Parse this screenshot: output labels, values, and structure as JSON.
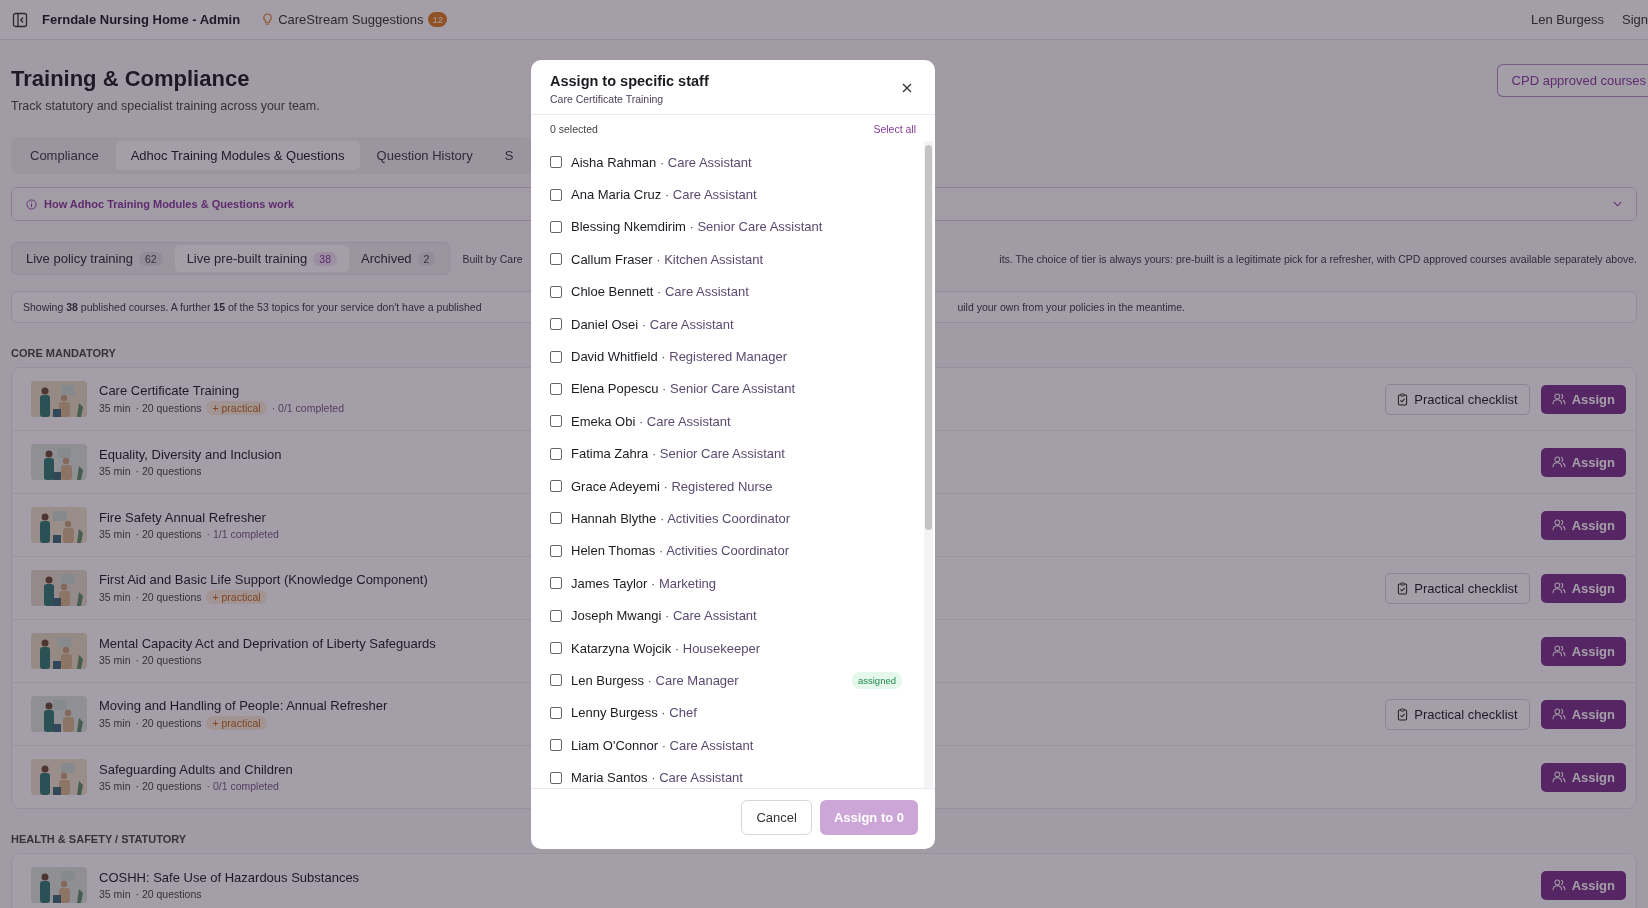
{
  "topbar": {
    "org": "Ferndale Nursing Home - Admin",
    "suggestions": "CareStream Suggestions",
    "suggestions_count": "12",
    "user": "Len Burgess",
    "sign": "Sign"
  },
  "header": {
    "title": "Training & Compliance",
    "subtitle": "Track statutory and specialist training across your team.",
    "cpd_button": "CPD approved courses"
  },
  "tabs": [
    {
      "label": "Compliance",
      "selected": false
    },
    {
      "label": "Adhoc Training Modules & Questions",
      "selected": true
    },
    {
      "label": "Question History",
      "selected": false
    },
    {
      "label": "S",
      "selected": false
    }
  ],
  "info_panel": {
    "label": "How Adhoc Training Modules & Questions work",
    "expanded": false
  },
  "subtabs": [
    {
      "label": "Live policy training",
      "count": "62",
      "selected": false
    },
    {
      "label": "Live pre-built training",
      "count": "38",
      "selected": true
    },
    {
      "label": "Archived",
      "count": "2",
      "selected": false
    }
  ],
  "subtabs_note_left": "Built by Care",
  "subtabs_note_right": "its. The choice of tier is always yours: pre-built is a legitimate pick for a refresher, with CPD approved courses available separately above.",
  "showing_left": "Showing **38** published courses. A further **15** of the 53 topics for your service don't have a published",
  "showing_right": "uild your own from your policies in the meantime.",
  "sections": [
    {
      "heading": "CORE MANDATORY",
      "courses": [
        {
          "title": "Care Certificate Training",
          "duration": "35 min",
          "questions": "· 20 questions",
          "practical": "+ practical",
          "completed": "· 0/1 completed",
          "checklist": "Practical checklist",
          "assign": "Assign"
        },
        {
          "title": "Equality, Diversity and Inclusion",
          "duration": "35 min",
          "questions": "· 20 questions",
          "assign": "Assign"
        },
        {
          "title": "Fire Safety Annual Refresher",
          "duration": "35 min",
          "questions": "· 20 questions",
          "completed": "· 1/1 completed",
          "assign": "Assign"
        },
        {
          "title": "First Aid and Basic Life Support (Knowledge Component)",
          "duration": "35 min",
          "questions": "· 20 questions",
          "practical": "+ practical",
          "checklist": "Practical checklist",
          "assign": "Assign"
        },
        {
          "title": "Mental Capacity Act and Deprivation of Liberty Safeguards",
          "duration": "35 min",
          "questions": "· 20 questions",
          "assign": "Assign"
        },
        {
          "title": "Moving and Handling of People: Annual Refresher",
          "duration": "35 min",
          "questions": "· 20 questions",
          "practical": "+ practical",
          "checklist": "Practical checklist",
          "assign": "Assign"
        },
        {
          "title": "Safeguarding Adults and Children",
          "duration": "35 min",
          "questions": "· 20 questions",
          "completed": "· 0/1 completed",
          "assign": "Assign"
        }
      ]
    },
    {
      "heading": "HEALTH & SAFETY / STATUTORY",
      "courses": [
        {
          "title": "COSHH: Safe Use of Hazardous Substances",
          "duration": "35 min",
          "questions": "· 20 questions",
          "assign": "Assign"
        }
      ]
    }
  ],
  "modal": {
    "title": "Assign to specific staff",
    "subtitle": "Care Certificate Training",
    "selected_count": "0 selected",
    "select_all": "Select all",
    "staff": [
      {
        "name": "Aisha Rahman",
        "role": "· Care Assistant",
        "checked": false
      },
      {
        "name": "Ana Maria Cruz",
        "role": "· Care Assistant",
        "checked": false
      },
      {
        "name": "Blessing Nkemdirim",
        "role": "· Senior Care Assistant",
        "checked": false
      },
      {
        "name": "Callum Fraser",
        "role": "· Kitchen Assistant",
        "checked": false
      },
      {
        "name": "Chloe Bennett",
        "role": "· Care Assistant",
        "checked": false
      },
      {
        "name": "Daniel Osei",
        "role": "· Care Assistant",
        "checked": false
      },
      {
        "name": "David Whitfield",
        "role": "· Registered Manager",
        "checked": false
      },
      {
        "name": "Elena Popescu",
        "role": "· Senior Care Assistant",
        "checked": false
      },
      {
        "name": "Emeka Obi",
        "role": "· Care Assistant",
        "checked": false
      },
      {
        "name": "Fatima Zahra",
        "role": "· Senior Care Assistant",
        "checked": false
      },
      {
        "name": "Grace Adeyemi",
        "role": "· Registered Nurse",
        "checked": false
      },
      {
        "name": "Hannah Blythe",
        "role": "· Activities Coordinator",
        "checked": false
      },
      {
        "name": "Helen Thomas",
        "role": "· Activities Coordinator",
        "checked": false
      },
      {
        "name": "James Taylor",
        "role": "· Marketing",
        "checked": false
      },
      {
        "name": "Joseph Mwangi",
        "role": "· Care Assistant",
        "checked": false
      },
      {
        "name": "Katarzyna Wojcik",
        "role": "· Housekeeper",
        "checked": false
      },
      {
        "name": "Len Burgess",
        "role": "· Care Manager",
        "checked": false,
        "badge": "assigned"
      },
      {
        "name": "Lenny Burgess",
        "role": "· Chef",
        "checked": false
      },
      {
        "name": "Liam O'Connor",
        "role": "· Care Assistant",
        "checked": false
      },
      {
        "name": "Maria Santos",
        "role": "· Care Assistant",
        "checked": false
      }
    ],
    "cancel": "Cancel",
    "confirm": "Assign to 0",
    "confirm_disabled": true
  }
}
